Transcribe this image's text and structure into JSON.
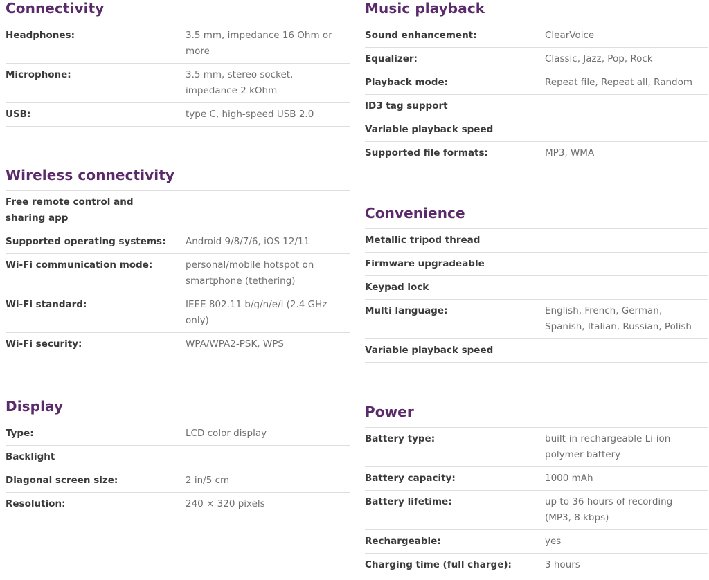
{
  "connectivity": {
    "title": "Connectivity",
    "rows": [
      {
        "label": "Headphones:",
        "value": "3.5 mm, impedance 16 Ohm or more"
      },
      {
        "label": "Microphone:",
        "value": "3.5 mm, stereo socket, impedance 2 kOhm"
      },
      {
        "label": "USB:",
        "value": "type C, high-speed USB 2.0"
      }
    ]
  },
  "wireless": {
    "title": "Wireless connectivity",
    "rows": [
      {
        "label": "Free remote control and sharing app",
        "value": ""
      },
      {
        "label": "Supported operating systems:",
        "value": "Android 9/8/7/6, iOS 12/11"
      },
      {
        "label": "Wi-Fi communication mode:",
        "value": "personal/mobile hotspot on smartphone (tethering)"
      },
      {
        "label": "Wi-Fi standard:",
        "value": "IEEE 802.11 b/g/n/e/i (2.4 GHz only)"
      },
      {
        "label": "Wi-Fi security:",
        "value": "WPA/WPA2-PSK, WPS"
      }
    ]
  },
  "display": {
    "title": "Display",
    "rows": [
      {
        "label": "Type:",
        "value": "LCD color display"
      },
      {
        "label": "Backlight",
        "value": ""
      },
      {
        "label": "Diagonal screen size:",
        "value": "2 in/5 cm"
      },
      {
        "label": "Resolution:",
        "value": "240 × 320 pixels"
      }
    ]
  },
  "music": {
    "title": "Music playback",
    "rows": [
      {
        "label": "Sound enhancement:",
        "value": "ClearVoice"
      },
      {
        "label": "Equalizer:",
        "value": "Classic, Jazz, Pop, Rock"
      },
      {
        "label": "Playback mode:",
        "value": "Repeat file, Repeat all, Random"
      },
      {
        "label": "ID3 tag support",
        "value": ""
      },
      {
        "label": "Variable playback speed",
        "value": ""
      },
      {
        "label": "Supported file formats:",
        "value": "MP3, WMA"
      }
    ]
  },
  "convenience": {
    "title": "Convenience",
    "rows": [
      {
        "label": "Metallic tripod thread",
        "value": ""
      },
      {
        "label": "Firmware upgradeable",
        "value": ""
      },
      {
        "label": "Keypad lock",
        "value": ""
      },
      {
        "label": "Multi language:",
        "value": "English, French, German, Spanish, Italian, Russian, Polish"
      },
      {
        "label": "Variable playback speed",
        "value": ""
      }
    ]
  },
  "power": {
    "title": "Power",
    "rows": [
      {
        "label": "Battery type:",
        "value": "built-in rechargeable Li-ion polymer battery"
      },
      {
        "label": "Battery capacity:",
        "value": "1000 mAh"
      },
      {
        "label": "Battery lifetime:",
        "value": "up to 36 hours of recording (MP3, 8 kbps)"
      },
      {
        "label": "Rechargeable:",
        "value": "yes"
      },
      {
        "label": "Charging time (full charge):",
        "value": "3 hours"
      }
    ]
  }
}
